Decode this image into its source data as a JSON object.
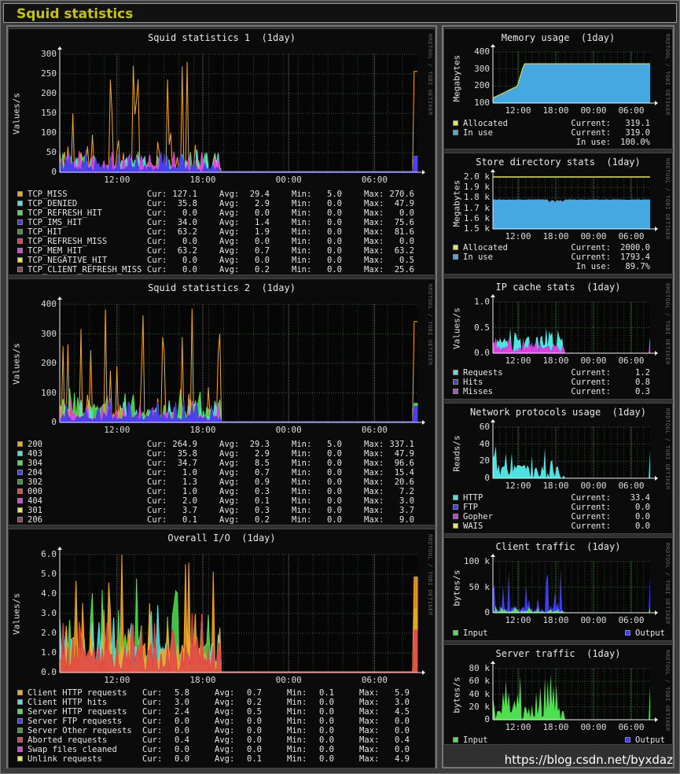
{
  "header": {
    "title": "Squid statistics"
  },
  "watermark": "https://blog.csdn.net/byxdaz",
  "rrdtool": "RRDTOOL / TOBI OETIKER",
  "colors": {
    "orange": "#f5a623",
    "cyan": "#4de3e3",
    "green": "#4fe04f",
    "blue": "#3e3ef0",
    "dkgreen": "#3a9a3a",
    "red": "#e04545",
    "magenta": "#e040e0",
    "yellow": "#e8e84a",
    "maroon": "#9a3c6a",
    "sky": "#45a8e0",
    "purple": "#c040e0"
  },
  "panels": [
    {
      "id": "s1",
      "title": "Squid statistics 1  (1day)",
      "ylabel": "Values/s",
      "yticks": [
        "300",
        "250",
        "200",
        "150",
        "100",
        "50",
        "0"
      ],
      "xticks": [
        "12:00",
        "18:00",
        "00:00",
        "06:00"
      ],
      "chart_data": {
        "type": "area",
        "title": "Squid statistics 1  (1day)",
        "ylabel": "Values/s",
        "ylim": [
          0,
          300
        ],
        "x": [
          "12:00",
          "18:00",
          "00:00",
          "06:00"
        ]
      },
      "legend": [
        {
          "name": "TCP_MISS",
          "color": "#f5a623",
          "cur": "127.1",
          "avg": "29.4",
          "min": "5.0",
          "max": "270.6"
        },
        {
          "name": "TCP_DENIED",
          "color": "#4de3e3",
          "cur": "35.8",
          "avg": "2.9",
          "min": "0.0",
          "max": "47.9"
        },
        {
          "name": "TCP_REFRESH_HIT",
          "color": "#4fe04f",
          "cur": "0.0",
          "avg": "0.0",
          "min": "0.0",
          "max": "0.0"
        },
        {
          "name": "TCP_IMS_HIT",
          "color": "#3e3ef0",
          "cur": "34.0",
          "avg": "1.4",
          "min": "0.0",
          "max": "75.6"
        },
        {
          "name": "TCP_HIT",
          "color": "#3a9a3a",
          "cur": "63.2",
          "avg": "1.9",
          "min": "0.0",
          "max": "81.6"
        },
        {
          "name": "TCP_REFRESH_MISS",
          "color": "#e04545",
          "cur": "0.0",
          "avg": "0.0",
          "min": "0.0",
          "max": "0.0"
        },
        {
          "name": "TCP_MEM_HIT",
          "color": "#e040e0",
          "cur": "63.2",
          "avg": "0.7",
          "min": "0.0",
          "max": "63.2"
        },
        {
          "name": "TCP_NEGATIVE_HIT",
          "color": "#e8e84a",
          "cur": "0.0",
          "avg": "0.0",
          "min": "0.0",
          "max": "0.5"
        },
        {
          "name": "TCP_CLIENT_REFRESH_MISS",
          "color": "#9a3c6a",
          "cur": "0.0",
          "avg": "0.2",
          "min": "0.0",
          "max": "25.6"
        }
      ]
    },
    {
      "id": "s2",
      "title": "Squid statistics 2  (1day)",
      "ylabel": "Values/s",
      "yticks": [
        "400",
        "300",
        "200",
        "100",
        "0"
      ],
      "xticks": [
        "12:00",
        "18:00",
        "00:00",
        "06:00"
      ],
      "chart_data": {
        "type": "area",
        "title": "Squid statistics 2  (1day)",
        "ylabel": "Values/s",
        "ylim": [
          0,
          400
        ],
        "x": [
          "12:00",
          "18:00",
          "00:00",
          "06:00"
        ]
      },
      "legend": [
        {
          "name": "200",
          "color": "#f5a623",
          "cur": "264.9",
          "avg": "29.3",
          "min": "5.0",
          "max": "337.1"
        },
        {
          "name": "403",
          "color": "#4de3e3",
          "cur": "35.8",
          "avg": "2.9",
          "min": "0.0",
          "max": "47.9"
        },
        {
          "name": "304",
          "color": "#4fe04f",
          "cur": "34.7",
          "avg": "8.5",
          "min": "0.0",
          "max": "96.6"
        },
        {
          "name": "204",
          "color": "#3e3ef0",
          "cur": "1.0",
          "avg": "0.7",
          "min": "0.0",
          "max": "15.4"
        },
        {
          "name": "302",
          "color": "#3a9a3a",
          "cur": "1.3",
          "avg": "0.9",
          "min": "0.0",
          "max": "20.6"
        },
        {
          "name": "000",
          "color": "#e04545",
          "cur": "1.0",
          "avg": "0.3",
          "min": "0.0",
          "max": "7.2"
        },
        {
          "name": "404",
          "color": "#e040e0",
          "cur": "2.0",
          "avg": "0.1",
          "min": "0.0",
          "max": "3.0"
        },
        {
          "name": "301",
          "color": "#e8e84a",
          "cur": "3.7",
          "avg": "0.3",
          "min": "0.0",
          "max": "3.7"
        },
        {
          "name": "206",
          "color": "#9a3c6a",
          "cur": "0.1",
          "avg": "0.2",
          "min": "0.0",
          "max": "9.0"
        }
      ]
    },
    {
      "id": "io",
      "title": "Overall I/O  (1day)",
      "ylabel": "Values/s",
      "yticks": [
        "6.0",
        "5.0",
        "4.0",
        "3.0",
        "2.0",
        "1.0",
        "0.0"
      ],
      "xticks": [
        "12:00",
        "18:00",
        "00:00",
        "06:00"
      ],
      "chart_data": {
        "type": "area",
        "title": "Overall I/O  (1day)",
        "ylabel": "Values/s",
        "ylim": [
          0,
          6
        ],
        "x": [
          "12:00",
          "18:00",
          "00:00",
          "06:00"
        ]
      },
      "legend": [
        {
          "name": "Client HTTP requests",
          "color": "#f5a623",
          "cur": "5.8",
          "avg": "0.7",
          "min": "0.1",
          "max": "5.9"
        },
        {
          "name": "Client HTTP hits",
          "color": "#4de3e3",
          "cur": "3.0",
          "avg": "0.2",
          "min": "0.0",
          "max": "3.0"
        },
        {
          "name": "Server HTTP requests",
          "color": "#4fe04f",
          "cur": "2.4",
          "avg": "0.5",
          "min": "0.0",
          "max": "4.5"
        },
        {
          "name": "Server FTP requests",
          "color": "#3e3ef0",
          "cur": "0.0",
          "avg": "0.0",
          "min": "0.0",
          "max": "0.0"
        },
        {
          "name": "Server Other requests",
          "color": "#3a9a3a",
          "cur": "0.0",
          "avg": "0.0",
          "min": "0.0",
          "max": "0.0"
        },
        {
          "name": "Aborted requests",
          "color": "#e04545",
          "cur": "0.4",
          "avg": "0.0",
          "min": "0.0",
          "max": "0.4"
        },
        {
          "name": "Swap files cleaned",
          "color": "#e040e0",
          "cur": "0.0",
          "avg": "0.0",
          "min": "0.0",
          "max": "0.0"
        },
        {
          "name": "Unlink requests",
          "color": "#e8e84a",
          "cur": "0.0",
          "avg": "0.1",
          "min": "0.0",
          "max": "4.9"
        }
      ]
    },
    {
      "id": "mem",
      "title": "Memory usage  (1day)",
      "ylabel": "Megabytes",
      "yticks": [
        "400",
        "300",
        "200",
        "100"
      ],
      "xticks": [
        "12:00",
        "18:00",
        "00:00",
        "06:00"
      ],
      "chart_data": {
        "type": "area",
        "title": "Memory usage  (1day)",
        "ylabel": "Megabytes",
        "ylim": [
          50,
          400
        ],
        "x": [
          "12:00",
          "18:00",
          "00:00",
          "06:00"
        ]
      },
      "legend": [
        {
          "name": "Allocated",
          "color": "#e8e84a",
          "label": "Current:",
          "val": "319.1"
        },
        {
          "name": "In use",
          "color": "#45a8e0",
          "label": "Current:",
          "val": "319.0"
        },
        {
          "name": "",
          "color": "",
          "label": "In use:",
          "val": "100.0%"
        }
      ]
    },
    {
      "id": "store",
      "title": "Store directory stats  (1day)",
      "ylabel": "Megabytes",
      "yticks": [
        "2.0 k",
        "1.9 k",
        "1.8 k",
        "1.7 k",
        "1.6 k",
        "1.5 k"
      ],
      "xticks": [
        "12:00",
        "18:00",
        "00:00",
        "06:00"
      ],
      "chart_data": {
        "type": "area",
        "title": "Store directory stats  (1day)",
        "ylabel": "Megabytes",
        "ylim": [
          1500,
          2000
        ],
        "x": [
          "12:00",
          "18:00",
          "00:00",
          "06:00"
        ]
      },
      "legend": [
        {
          "name": "Allocated",
          "color": "#e8e84a",
          "label": "Current:",
          "val": "2000.0"
        },
        {
          "name": "In use",
          "color": "#45a8e0",
          "label": "Current:",
          "val": "1793.4"
        },
        {
          "name": "",
          "color": "",
          "label": "In use:",
          "val": "89.7%"
        }
      ]
    },
    {
      "id": "ip",
      "title": "IP cache stats  (1day)",
      "ylabel": "Values/s",
      "yticks": [
        "1.0",
        "0.5",
        "0.0"
      ],
      "xticks": [
        "12:00",
        "18:00",
        "00:00",
        "06:00"
      ],
      "chart_data": {
        "type": "area",
        "title": "IP cache stats  (1day)",
        "ylabel": "Values/s",
        "ylim": [
          0,
          1.5
        ],
        "x": [
          "12:00",
          "18:00",
          "00:00",
          "06:00"
        ]
      },
      "legend": [
        {
          "name": "Requests",
          "color": "#4de3e3",
          "label": "Current:",
          "val": "1.2"
        },
        {
          "name": "Hits",
          "color": "#3e3ef0",
          "label": "Current:",
          "val": "0.8"
        },
        {
          "name": "Misses",
          "color": "#c040e0",
          "label": "Current:",
          "val": "0.3"
        }
      ]
    },
    {
      "id": "net",
      "title": "Network protocols usage  (1day)",
      "ylabel": "Reads/s",
      "yticks": [
        "60",
        "40",
        "20",
        "0"
      ],
      "xticks": [
        "12:00",
        "18:00",
        "00:00",
        "06:00"
      ],
      "chart_data": {
        "type": "area",
        "title": "Network protocols usage  (1day)",
        "ylabel": "Reads/s",
        "ylim": [
          0,
          70
        ],
        "x": [
          "12:00",
          "18:00",
          "00:00",
          "06:00"
        ]
      },
      "legend": [
        {
          "name": "HTTP",
          "color": "#4de3e3",
          "label": "Current:",
          "val": "33.4"
        },
        {
          "name": "FTP",
          "color": "#3e3ef0",
          "label": "Current:",
          "val": "0.0"
        },
        {
          "name": "Gopher",
          "color": "#c040e0",
          "label": "Current:",
          "val": "0.0"
        },
        {
          "name": "WAIS",
          "color": "#e8e84a",
          "label": "Current:",
          "val": "0.0"
        }
      ]
    },
    {
      "id": "client",
      "title": "Client traffic  (1day)",
      "ylabel": "bytes/s",
      "yticks": [
        "100 k",
        "50 k",
        "0"
      ],
      "xticks": [
        "12:00",
        "18:00",
        "00:00",
        "06:00"
      ],
      "chart_data": {
        "type": "area",
        "title": "Client traffic  (1day)",
        "ylabel": "bytes/s",
        "ylim": [
          0,
          110000
        ],
        "x": [
          "12:00",
          "18:00",
          "00:00",
          "06:00"
        ]
      },
      "legend2": [
        {
          "name": "Input",
          "color": "#4fe04f"
        },
        {
          "name": "Output",
          "color": "#3e3ef0"
        }
      ]
    },
    {
      "id": "server",
      "title": "Server traffic  (1day)",
      "ylabel": "bytes/s",
      "yticks": [
        "80 k",
        "60 k",
        "40 k",
        "20 k",
        "0"
      ],
      "xticks": [
        "12:00",
        "18:00",
        "00:00",
        "06:00"
      ],
      "chart_data": {
        "type": "area",
        "title": "Server traffic  (1day)",
        "ylabel": "bytes/s",
        "ylim": [
          0,
          90000
        ],
        "x": [
          "12:00",
          "18:00",
          "00:00",
          "06:00"
        ]
      },
      "legend2": [
        {
          "name": "Input",
          "color": "#4fe04f"
        },
        {
          "name": "Output",
          "color": "#3e3ef0"
        }
      ]
    }
  ],
  "labels": {
    "cur": "Cur:",
    "avg": "Avg:",
    "min": "Min:",
    "max": "Max:"
  }
}
